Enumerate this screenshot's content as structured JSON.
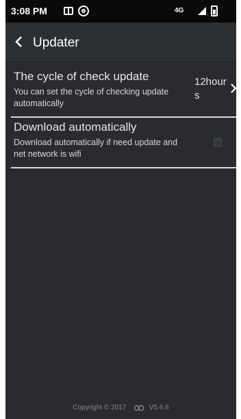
{
  "status_bar": {
    "time": "3:08 PM",
    "network": "4G"
  },
  "toolbar": {
    "title": "Updater"
  },
  "settings": [
    {
      "title": "The cycle of check update",
      "description": "You can set the cycle of checking update automatically",
      "value": "12hours"
    },
    {
      "title": "Download automatically",
      "description": "Download automatically if need update and net network is wifi",
      "checked": false
    }
  ],
  "footer": {
    "copyright": "Copyright © 2017",
    "version": "V5.6.6"
  },
  "colors": {
    "background": "#292b2f",
    "status_bar": "#0a0a0a",
    "divider": "#d9d9d9"
  },
  "icons": [
    "back-icon",
    "chevron-right-icon",
    "cloud-icon",
    "signal-icon",
    "battery-icon"
  ]
}
